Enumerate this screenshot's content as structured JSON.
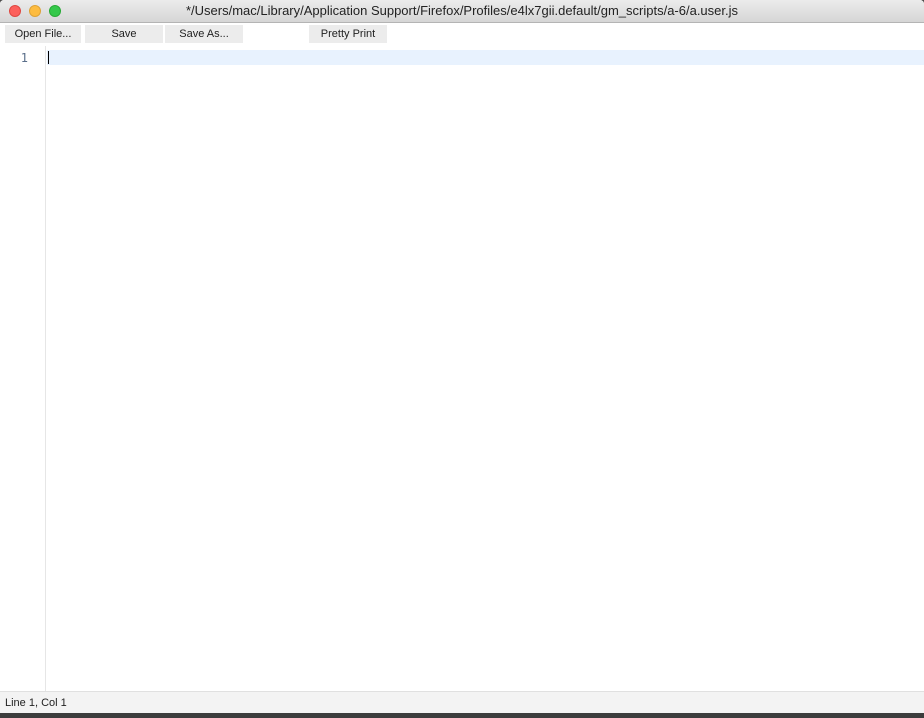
{
  "window": {
    "title": "*/Users/mac/Library/Application Support/Firefox/Profiles/e4lx7gii.default/gm_scripts/a-6/a.user.js"
  },
  "toolbar": {
    "open_label": "Open File...",
    "save_label": "Save",
    "save_as_label": "Save As...",
    "pretty_print_label": "Pretty Print"
  },
  "editor": {
    "line_numbers": [
      "1"
    ],
    "content": ""
  },
  "status": {
    "position": "Line 1, Col 1"
  },
  "colors": {
    "active_line": "#e8f2fe",
    "close": "#fc605c",
    "minimize": "#fdbc40",
    "maximize": "#34c84a"
  }
}
